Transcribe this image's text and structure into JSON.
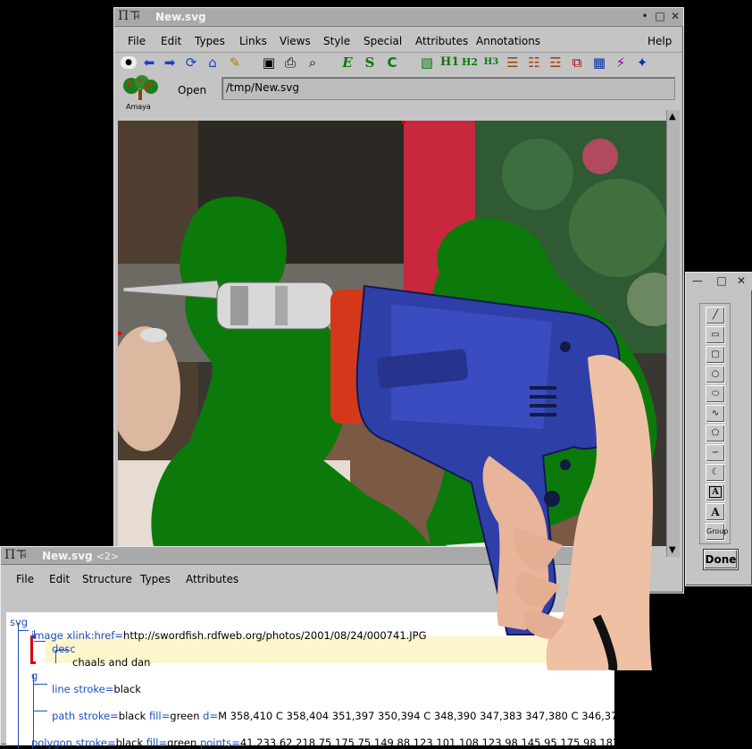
{
  "main_window": {
    "title": "New.svg",
    "menu": [
      "File",
      "Edit",
      "Types",
      "Links",
      "Views",
      "Style",
      "Special",
      "Attributes",
      "Annotations",
      "Help"
    ],
    "toolbar_icons": [
      "stop-icon",
      "back-icon",
      "forward-icon",
      "reload-icon",
      "home-icon",
      "edit-icon",
      "save-icon",
      "print-icon",
      "find-icon",
      "emphasis-icon",
      "strong-icon",
      "code-icon",
      "image-icon",
      "h1-icon",
      "h2-icon",
      "h3-icon",
      "bulleted-list-icon",
      "numbered-list-icon",
      "definition-list-icon",
      "object-icon",
      "table-icon",
      "math-icon",
      "plugin-icon"
    ],
    "toolbar_glyphs": {
      "emphasis": "E",
      "strong": "S",
      "code": "C",
      "h1": "H1",
      "h2": "H2",
      "h3": "H3"
    },
    "logo_label": "Amaya",
    "open_label": "Open",
    "url": "/tmp/New.svg"
  },
  "structure_window": {
    "title": "New.svg",
    "subtitle": "<2>",
    "menu": [
      "File",
      "Edit",
      "Structure",
      "Types",
      "Attributes"
    ],
    "tree": {
      "svg": "svg",
      "image_tag": "image",
      "image_attr": "xlink:href",
      "image_value": "http://swordfish.rdfweb.org/photos/2001/08/24/000741.JPG",
      "desc_tag": "desc",
      "desc_text": "chaals and dan",
      "g_tag": "g",
      "line_tag": "line",
      "line_attr": "stroke",
      "line_value": "black",
      "path_tag": "path",
      "path_attr1": "stroke",
      "path_value1": "black",
      "path_attr2": "fill",
      "path_value2": "green",
      "path_attr3": "d",
      "path_value3": "M 358,410 C 358,404 351,397 350,394 C 348,390 347,383 347,380 C 346,37",
      "polygon_tag": "polygon",
      "polygon_attr1": "stroke",
      "polygon_value1": "black",
      "polygon_attr2": "fill",
      "polygon_value2": "green",
      "polygon_attr3": "points",
      "polygon_value3": "41,233 62,218 75,175 75,149 88,123 101,108 123,98 145,95 175,98 183,"
    }
  },
  "palette": {
    "tools": [
      "line-tool",
      "rectangle-tool",
      "rounded-rectangle-tool",
      "circle-tool",
      "ellipse-tool",
      "polyline-tool",
      "polygon-tool",
      "spline-tool",
      "closed-spline-tool",
      "foreign-object-tool",
      "text-tool",
      "group-tool"
    ],
    "text_glyph": "A",
    "group_label": "Group",
    "done_label": "Done"
  },
  "colors": {
    "shape_fill": "#0b7a0b",
    "selection_highlight": "#fdf6cc",
    "keyword": "#1a4fc4",
    "drill_body": "#2f3fa8"
  }
}
